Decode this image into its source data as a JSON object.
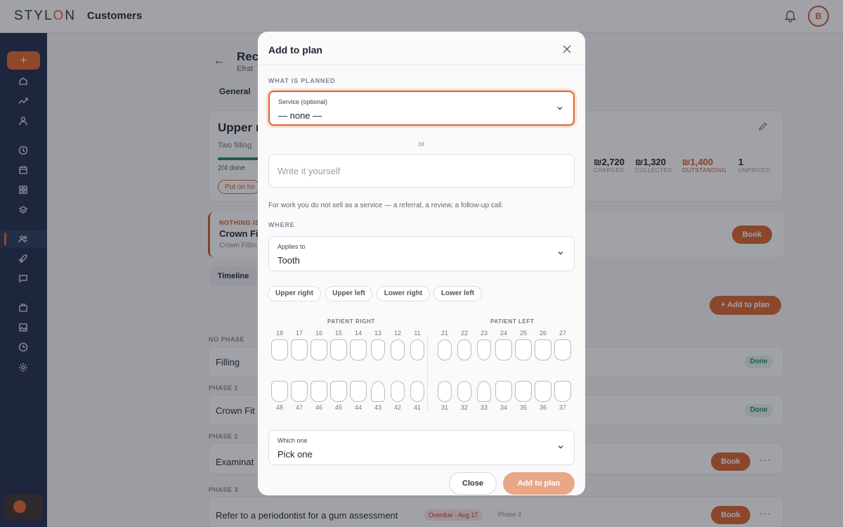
{
  "app": {
    "logo": "STYLON",
    "logo_accent_letter": "O",
    "page_title": "Customers",
    "avatar_initial": "B"
  },
  "sidebar": {
    "add_label": "+",
    "icons": [
      "home-icon",
      "trend-icon",
      "user-icon",
      "clock-icon",
      "calendar-icon",
      "grid-icon",
      "layers-icon",
      "users-icon",
      "rocket-icon",
      "chat-icon",
      "briefcase-icon",
      "image-icon",
      "history-icon",
      "gear-icon"
    ],
    "active": "users-icon"
  },
  "background": {
    "record_title": "Rec",
    "record_sub": "Efrat",
    "tab_general": "General",
    "plan_title": "Upper r",
    "plan_sub": "Two filling",
    "progress_text": "2/4 done",
    "put_on_hold": "Put on ho",
    "stats": [
      {
        "value": "₪2,720",
        "label": "CHARGED"
      },
      {
        "value": "₪1,320",
        "label": "COLLECTED"
      },
      {
        "value": "₪1,400",
        "label": "OUTSTANDING"
      },
      {
        "value": "1",
        "label": "UNPRICED"
      }
    ],
    "nothing_label": "NOTHING IS",
    "next_title": "Crown Fit",
    "next_sub": "Crown Fittin",
    "book": "Book",
    "timeline": "Timeline",
    "add_to_plan": "+ Add to plan",
    "sections": [
      {
        "label": "NO PHASE",
        "title": "Filling",
        "status": "Done"
      },
      {
        "label": "PHASE 1",
        "title": "Crown Fit",
        "status": "Done"
      },
      {
        "label": "PHASE 2",
        "title": "Examinat",
        "status": "Book"
      },
      {
        "label": "PHASE 3",
        "title": "Refer to a periodontist for a gum assessment",
        "status": "Book"
      }
    ],
    "overdue": "Overdue · Aug 17",
    "phase3_tag": "Phase 3",
    "more": "···"
  },
  "modal": {
    "title": "Add to plan",
    "what_label": "WHAT IS PLANNED",
    "service_label": "Service (optional)",
    "service_value": "— none —",
    "or": "or",
    "write_placeholder": "Write it yourself",
    "hint": "For work you do not sell as a service — a referral, a review, a follow-up call.",
    "where_label": "WHERE",
    "applies_label": "Applies to",
    "applies_value": "Tooth",
    "chips": [
      "Upper right",
      "Upper left",
      "Lower right",
      "Lower left"
    ],
    "patient_right": "PATIENT RIGHT",
    "patient_left": "PATIENT LEFT",
    "upper_teeth": [
      "18",
      "17",
      "16",
      "15",
      "14",
      "13",
      "12",
      "11",
      "21",
      "22",
      "23",
      "24",
      "25",
      "26",
      "27"
    ],
    "lower_teeth": [
      "48",
      "47",
      "46",
      "45",
      "44",
      "43",
      "42",
      "41",
      "31",
      "32",
      "33",
      "34",
      "35",
      "36",
      "37"
    ],
    "which_label": "Which one",
    "which_value": "Pick one",
    "close": "Close",
    "add": "Add to plan"
  },
  "colors": {
    "accent": "#e2622b",
    "sidebar": "#1c2a47",
    "done": "#1c8a5e",
    "overdue": "#c0392b"
  }
}
